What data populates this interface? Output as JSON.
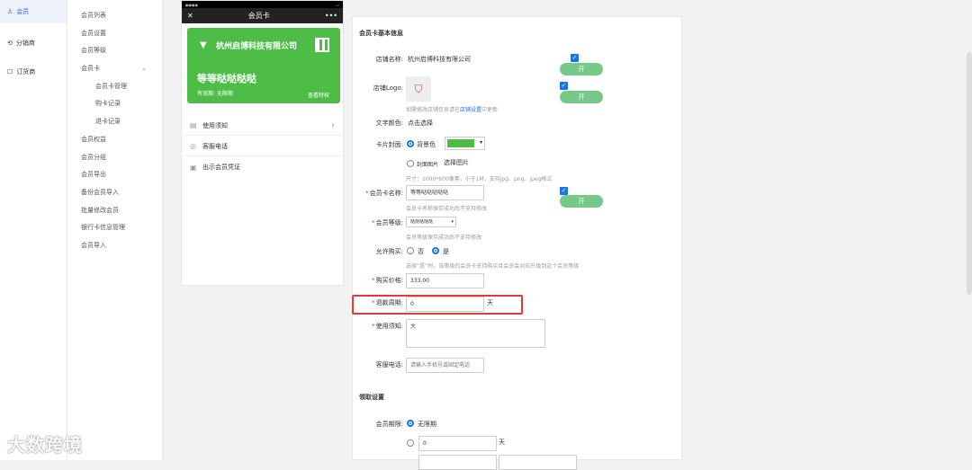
{
  "nav1": [
    "会员",
    "分销商",
    "订货商"
  ],
  "nav2": {
    "items": [
      "会员列表",
      "会员设置",
      "会员等级",
      "会员卡"
    ],
    "sub": [
      "会员卡管理",
      "购卡记录",
      "退卡记录"
    ],
    "rest": [
      "会员权益",
      "会员分组",
      "会员导出",
      "备份会员导入",
      "批量修改会员",
      "银行卡信息管理",
      "会员导入"
    ]
  },
  "phone": {
    "title": "会员卡",
    "card": {
      "shop": "杭州启博科技有限公司",
      "name": "等等哒哒哒哒",
      "expire": "有效期: 无限期",
      "priv": "查看特权",
      "color": "#4dbd47"
    },
    "rows": [
      "使用须知",
      "客服电话",
      "出示会员凭证"
    ]
  },
  "form": {
    "sec_basic": "会员卡基本信息",
    "shop_label": "店铺名称:",
    "shop_value": "杭州启博科技有限公司",
    "toggle": "开",
    "logo_label": "店铺Logo:",
    "logo_hint": "如需修改店铺信息请在",
    "logo_hint_link": "店铺设置",
    "logo_hint_end": "中更新",
    "textcolor_label": "文字颜色:",
    "textcolor_value": "点击选择",
    "cover_label": "卡片封面:",
    "cover_bg": "背景色",
    "cover_img": "封面图片",
    "cover_img_btn": "选择图片",
    "cover_hint": "尺寸：1000*600像素，小于1M，支持jpg、png、jpeg格式",
    "name_label": "会员卡名称:",
    "name_value": "等等哒哒哒哒哒",
    "name_hint": "会员卡名称保存成功后不支持修改",
    "level_label": "会员等级:",
    "level_value": "哒哒哒哒哒",
    "level_hint": "会员等级保存成功后不支持修改",
    "buy_label": "允许购买:",
    "buy_no": "否",
    "buy_yes": "是",
    "buy_hint": "选择“是”时，该等级的会员卡支持购买且会员会对应升级到这个会员等级",
    "price_label": "购买价格:",
    "price_value": "333.00",
    "refund_label": "退款周期:",
    "refund_value": "0",
    "refund_unit": "天",
    "notice_label": "使用须知:",
    "notice_value": "大",
    "tel_label": "客服电话:",
    "tel_placeholder": "请输入手机号或固定电话",
    "sec_receive": "领取设置",
    "period_label": "会员期限:",
    "period_unlimited": "无限期",
    "period_days_value": "0",
    "period_days_unit": "天"
  },
  "watermark": "大数跨境"
}
